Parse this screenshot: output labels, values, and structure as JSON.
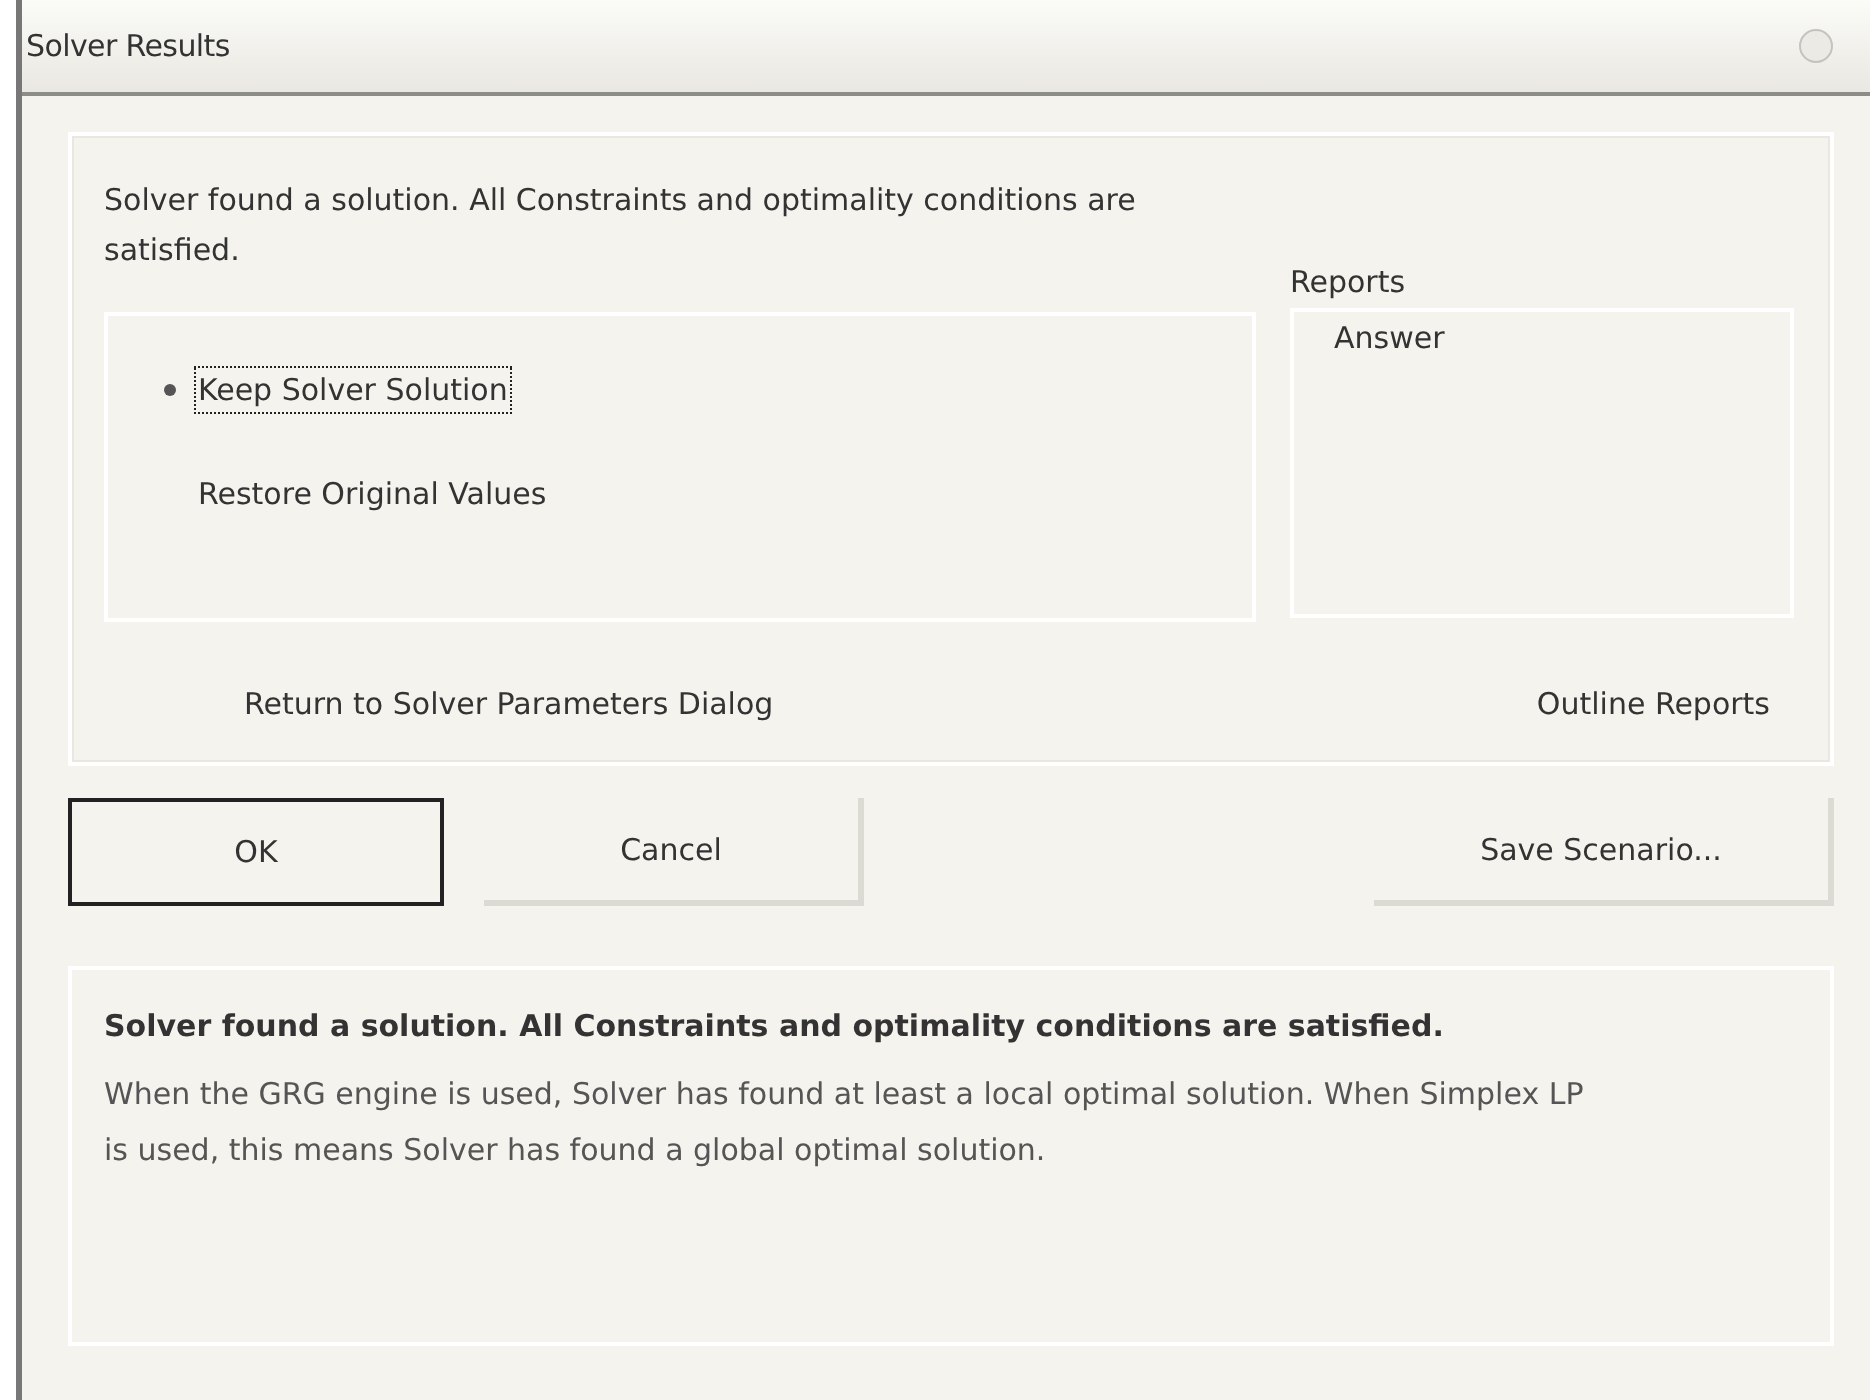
{
  "window": {
    "title": "Solver Results"
  },
  "message": "Solver found a solution.  All Constraints and optimality conditions are satisfied.",
  "options": [
    {
      "label": "Keep Solver Solution",
      "selected": true
    },
    {
      "label": "Restore Original Values",
      "selected": false
    }
  ],
  "reports": {
    "label": "Reports",
    "items": [
      {
        "label": "Answer",
        "selected": false
      }
    ]
  },
  "return_checkbox": {
    "label": "Return to Solver Parameters Dialog",
    "checked": false
  },
  "outline_checkbox": {
    "label": "Outline Reports",
    "checked": false
  },
  "buttons": [
    {
      "label": "OK",
      "default": true
    },
    {
      "label": "Cancel",
      "default": false
    },
    {
      "label": "Save Scenario...",
      "default": false
    }
  ],
  "description": {
    "title": "Solver found a solution.  All Constraints and optimality conditions are satisfied.",
    "body": "When the GRG engine is used, Solver has found at least a local optimal solution. When Simplex LP is used, this means Solver has found a global optimal solution."
  }
}
